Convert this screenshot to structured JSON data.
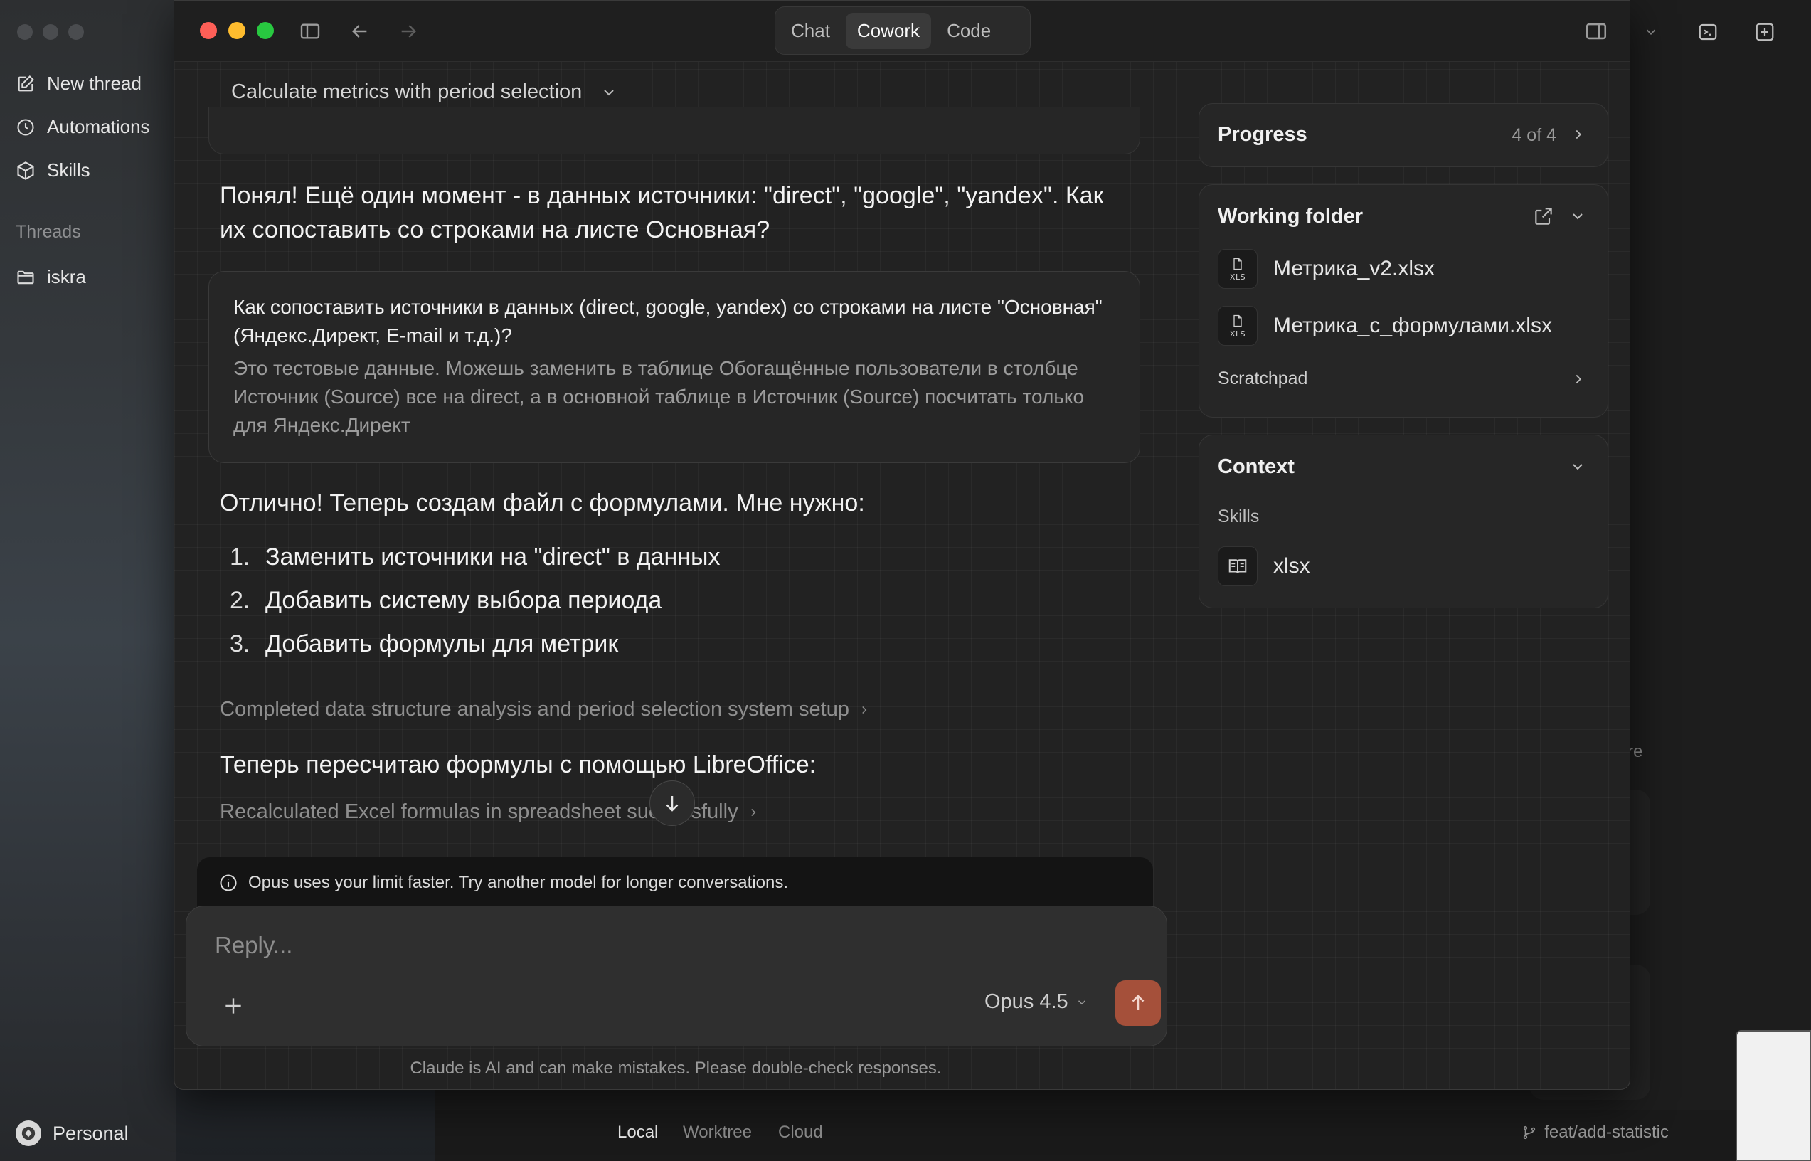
{
  "sidebar": {
    "items": [
      {
        "label": "New thread",
        "icon": "compose-icon"
      },
      {
        "label": "Automations",
        "icon": "clock-icon"
      },
      {
        "label": "Skills",
        "icon": "cube-icon"
      }
    ],
    "threads_label": "Threads",
    "threads": [
      {
        "label": "iskra",
        "icon": "folder-icon"
      }
    ],
    "account": "Personal"
  },
  "back_window": {
    "bottom_tabs": [
      "Local",
      "Worktree",
      "Cloud"
    ],
    "active_tab": "Local",
    "branch": "feat/add-statistic",
    "partial_text": "re"
  },
  "window": {
    "modes": [
      "Chat",
      "Cowork",
      "Code"
    ],
    "active_mode": "Cowork"
  },
  "chat": {
    "title": "Calculate metrics with period selection",
    "message1": "Понял! Ещё один момент - в данных источники: \"direct\", \"google\", \"yandex\". Как их сопоставить со строками на листе Основная?",
    "question": {
      "title": "Как сопоставить источники в данных (direct, google, yandex) со строками на листе \"Основная\" (Яндекс.Директ, E-mail и т.д.)?",
      "answer": "Это тестовые данные. Можешь заменить в таблице Обогащённые пользователи в столбце Источник (Source) все на direct, а в основной таблице в Источник (Source) посчитать только для Яндекс.Директ"
    },
    "message2": "Отлично! Теперь создам файл с формулами. Мне нужно:",
    "steps": [
      {
        "num": "1.",
        "text": "Заменить источники на \"direct\" в данных"
      },
      {
        "num": "2.",
        "text": "Добавить систему выбора периода"
      },
      {
        "num": "3.",
        "text": "Добавить формулы для метрик"
      }
    ],
    "collapsed1": "Completed data structure analysis and period selection system setup",
    "message3": "Теперь пересчитаю формулы с помощью LibreOffice:",
    "collapsed2": "Recalculated Excel formulas in spreadsheet successfully",
    "warning": "Opus uses your limit faster. Try another model for longer conversations.",
    "reply_placeholder": "Reply...",
    "model": "Opus 4.5",
    "disclaimer": "Claude is AI and can make mistakes. Please double-check responses."
  },
  "panel": {
    "progress": {
      "title": "Progress",
      "count": "4 of 4"
    },
    "working_folder": {
      "title": "Working folder",
      "files": [
        "Метрика_v2.xlsx",
        "Метрика_с_формулами.xlsx"
      ],
      "scratchpad": "Scratchpad",
      "file_badge": "XLS"
    },
    "context": {
      "title": "Context",
      "skills_label": "Skills",
      "skills": [
        "xlsx"
      ]
    }
  },
  "colors": {
    "accent_send": "#a5503a",
    "window_bg": "#222222",
    "card_bg": "#262626"
  }
}
